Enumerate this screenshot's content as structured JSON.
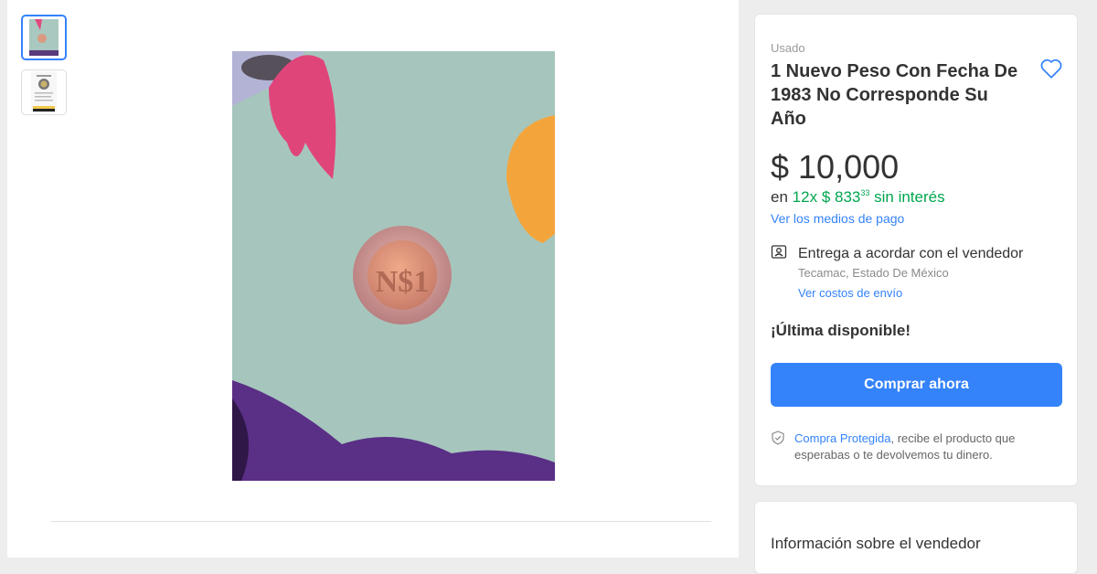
{
  "gallery": {
    "thumbnails": [
      "coin-photo-1",
      "coin-photo-2"
    ],
    "selected_index": 0
  },
  "product": {
    "condition": "Usado",
    "title": "1 Nuevo Peso Con Fecha De 1983 No Corresponde Su Año",
    "coin_text": "N$1"
  },
  "price": {
    "amount": "$ 10,000",
    "installments_prefix": "en",
    "installments_count": "12x",
    "installments_amount": "$ 833",
    "installments_cents": "33",
    "installments_suffix": "sin interés",
    "payment_link": "Ver los medios de pago"
  },
  "shipping": {
    "title": "Entrega a acordar con el vendedor",
    "location": "Tecamac, Estado De México",
    "link": "Ver costos de envío"
  },
  "stock": "¡Última disponible!",
  "buy_button": "Comprar ahora",
  "protection": {
    "link": "Compra Protegida",
    "text": ", recibe el producto que esperabas o te devolvemos tu dinero."
  },
  "seller": {
    "title": "Información sobre el vendedor"
  },
  "colors": {
    "accent": "#3483fa",
    "green": "#00a650"
  }
}
